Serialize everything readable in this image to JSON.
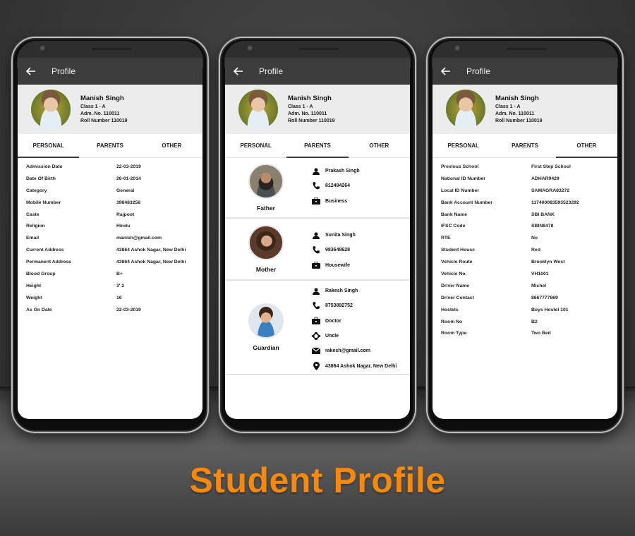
{
  "footer_title": "Student Profile",
  "accent_color": "#f5890e",
  "appbar_color": "#3c3c3c",
  "student": {
    "name": "Manish Singh",
    "class": "Class 1 - A",
    "adm_no": "Adm. No.  110011",
    "roll_no": "Roll Number  110019"
  },
  "screens": [
    {
      "appbar_title": "Profile",
      "back_icon": "arrow-left-icon",
      "tabs": [
        {
          "label": "PERSONAL",
          "active": true
        },
        {
          "label": "PARENTS",
          "active": false
        },
        {
          "label": "OTHER",
          "active": false
        }
      ],
      "fields": [
        {
          "k": "Admission Date",
          "v": "22-03-2019"
        },
        {
          "k": "Date Of Birth",
          "v": "26-01-2014"
        },
        {
          "k": "Category",
          "v": "General"
        },
        {
          "k": "Mobile Number",
          "v": "398483258"
        },
        {
          "k": "Caste",
          "v": "Rajpoot"
        },
        {
          "k": "Religion",
          "v": "Hindu"
        },
        {
          "k": "Email",
          "v": "manish@gmail.com"
        },
        {
          "k": "Current Address",
          "v": "43864 Ashok Nagar, New Delhi"
        },
        {
          "k": "Permanent Address",
          "v": "43864 Ashok Nagar, New Delhi"
        },
        {
          "k": "Blood Group",
          "v": "B+"
        },
        {
          "k": "Height",
          "v": "3' 2"
        },
        {
          "k": "Weight",
          "v": "16"
        },
        {
          "k": "As On Date",
          "v": "22-03-2019"
        }
      ]
    },
    {
      "appbar_title": "Profile",
      "back_icon": "arrow-left-icon",
      "tabs": [
        {
          "label": "PERSONAL",
          "active": false
        },
        {
          "label": "PARENTS",
          "active": true
        },
        {
          "label": "OTHER",
          "active": false
        }
      ],
      "parents": [
        {
          "relation": "Father",
          "name": "Prakash Singh",
          "phone": "812484264",
          "occupation": "Business"
        },
        {
          "relation": "Mother",
          "name": "Sunita Singh",
          "phone": "983648628",
          "occupation": "Housewife"
        },
        {
          "relation": "Guardian",
          "name": "Rakesh Singh",
          "phone": "8753892752",
          "occupation": "Doctor",
          "relationship": "Uncle",
          "email": "rakesh@gmail.com",
          "address": "43864 Ashok Nagar, New Delhi"
        }
      ]
    },
    {
      "appbar_title": "Profile",
      "back_icon": "arrow-left-icon",
      "tabs": [
        {
          "label": "PERSONAL",
          "active": false
        },
        {
          "label": "PARENTS",
          "active": false
        },
        {
          "label": "OTHER",
          "active": true
        }
      ],
      "fields": [
        {
          "k": "Previous School",
          "v": "First Step School"
        },
        {
          "k": "National ID Number",
          "v": "ADHAR9429"
        },
        {
          "k": "Local ID Number",
          "v": "SAMAGRA83272"
        },
        {
          "k": "Bank Account Number",
          "v": "117400083593523292"
        },
        {
          "k": "Bank Name",
          "v": "SBI BANK"
        },
        {
          "k": "IFSC Code",
          "v": "SBIN8478"
        },
        {
          "k": "RTE",
          "v": "No"
        },
        {
          "k": "Student House",
          "v": "Red"
        },
        {
          "k": "Vehicle Route",
          "v": "Brooklyn West"
        },
        {
          "k": "Vehicle No.",
          "v": "VH1001"
        },
        {
          "k": "Driver Name",
          "v": "Michel"
        },
        {
          "k": "Driver Contact",
          "v": "8667777869"
        },
        {
          "k": "Hostels",
          "v": "Boys Hostel 101"
        },
        {
          "k": "Room No",
          "v": "B2"
        },
        {
          "k": "Room Type",
          "v": "Two Bed"
        }
      ]
    }
  ]
}
